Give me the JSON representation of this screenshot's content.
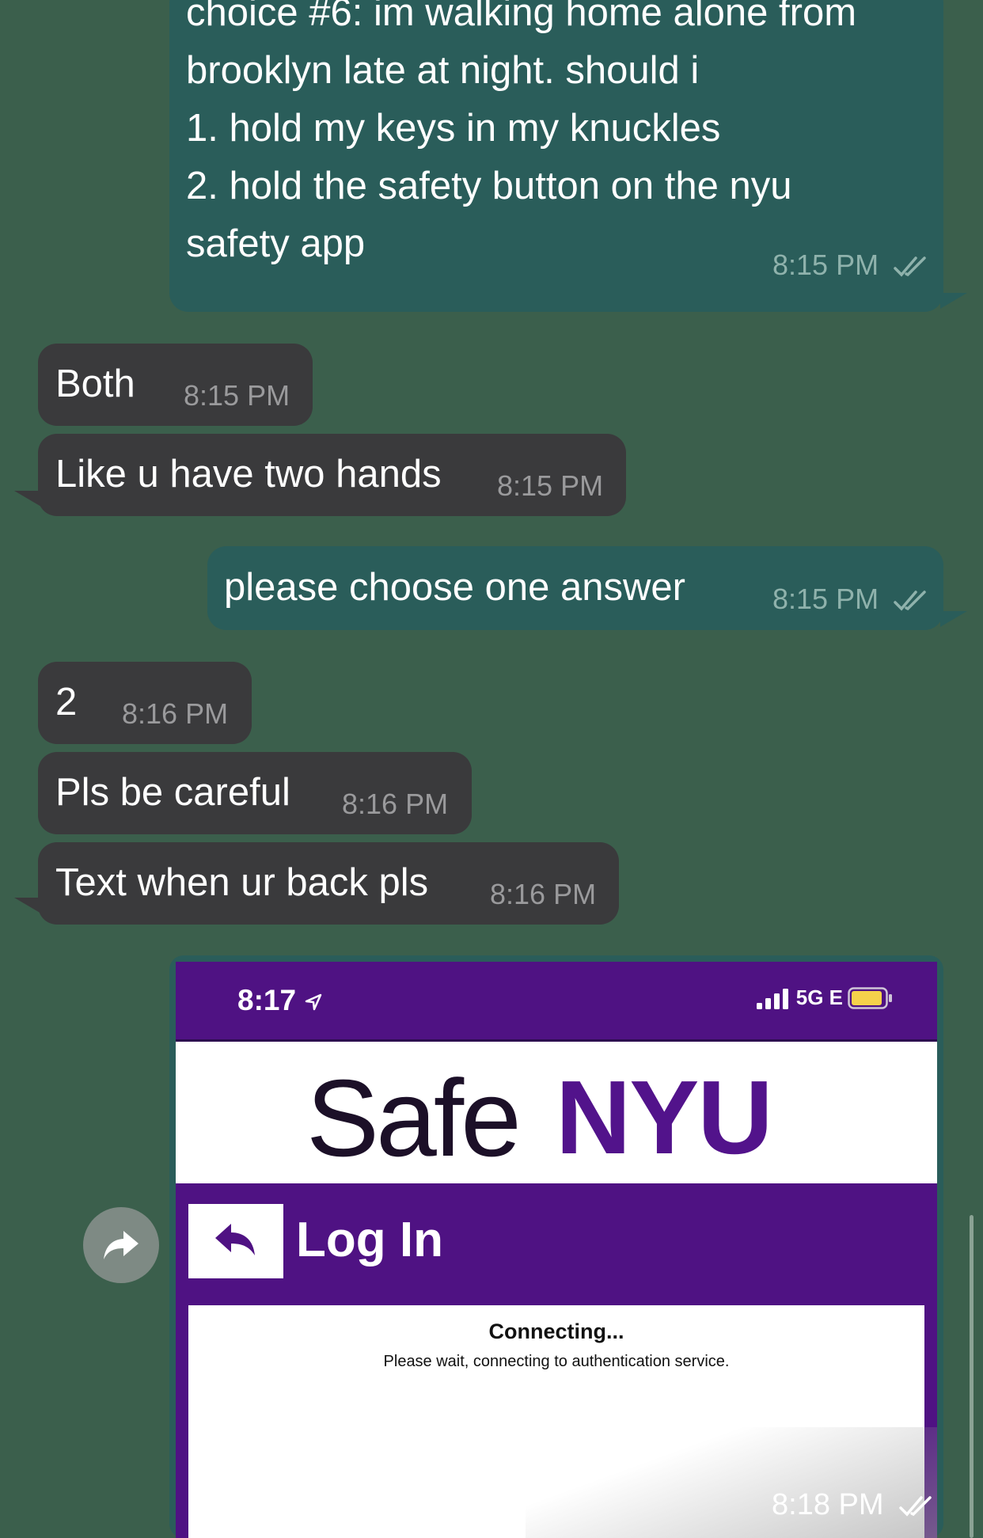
{
  "messages": [
    {
      "text": "choice #6: im walking home alone from\nbrooklyn late at night. should i\n1. hold my keys in my knuckles\n2. hold the safety button on the nyu\nsafety app",
      "time": "8:15 PM"
    },
    {
      "text": "Both",
      "time": "8:15 PM"
    },
    {
      "text": "Like u have two hands",
      "time": "8:15 PM"
    },
    {
      "text": "please choose one answer",
      "time": "8:15 PM"
    },
    {
      "text": "2",
      "time": "8:16 PM"
    },
    {
      "text": "Pls be careful",
      "time": "8:16 PM"
    },
    {
      "text": "Text when ur back pls",
      "time": "8:16 PM"
    }
  ],
  "image_message": {
    "time": "8:18 PM",
    "screenshot": {
      "status_time": "8:17",
      "network": "5G E",
      "logo_safe": "Safe",
      "logo_nyu": "NYU",
      "login_title": "Log In",
      "connecting_title": "Connecting...",
      "connecting_subtitle": "Please wait, connecting to authentication service."
    }
  },
  "colors": {
    "background": "#3b5f4c",
    "outgoing_bubble": "#2a5d5a",
    "incoming_bubble": "#3a3a3c",
    "nyu_purple": "#4f1283"
  }
}
